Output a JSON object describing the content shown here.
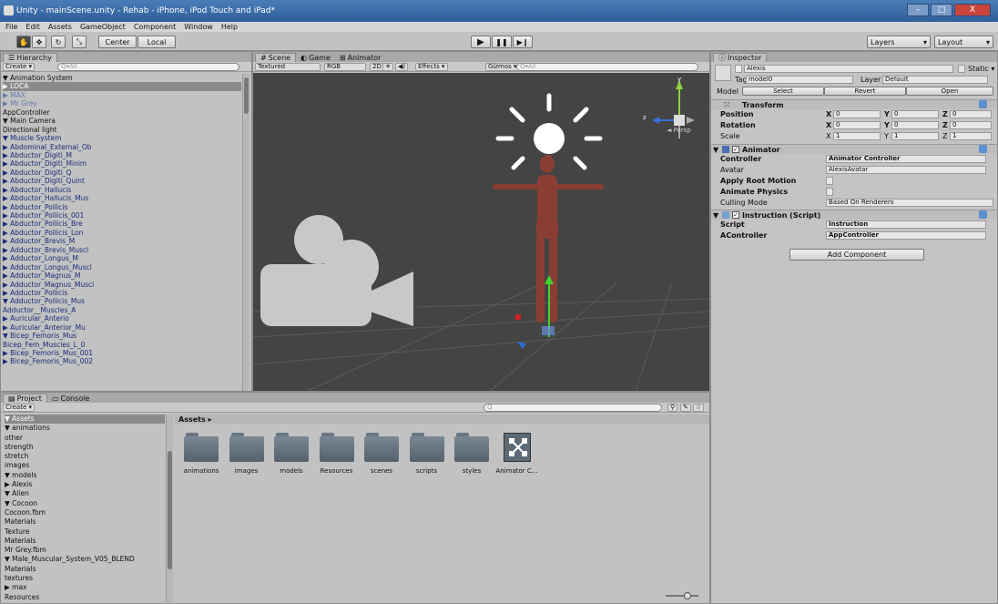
{
  "window": {
    "title": "Unity - mainScene.unity - Rehab - iPhone, iPod Touch and iPad*",
    "min": "–",
    "max": "□",
    "close": "X"
  },
  "menu": [
    "File",
    "Edit",
    "Assets",
    "GameObject",
    "Component",
    "Window",
    "Help"
  ],
  "toolbar": {
    "center": "Center",
    "local": "Local",
    "play": "▶",
    "pause": "❚❚",
    "step": "▶❙",
    "layers": "Layers",
    "layout": "Layout",
    "hand": "✋",
    "move": "✥",
    "rotate": "↻",
    "scale": "⤡"
  },
  "hierarchy": {
    "tab": "Hierarchy",
    "create": "Create ▾",
    "search": "Q▾All",
    "rows": [
      {
        "t": "▼ Animation System",
        "c": "blk"
      },
      {
        "t": "   ▶ LOCA",
        "c": "sel"
      },
      {
        "t": "   ▶ MAX",
        "c": "dim"
      },
      {
        "t": "   ▶ Mr Grey",
        "c": "dim"
      },
      {
        "t": "   AppController",
        "c": "blk"
      },
      {
        "t": "▼ Main Camera",
        "c": "blk"
      },
      {
        "t": "      Directional light",
        "c": "blk"
      },
      {
        "t": "▼ Muscle System",
        "c": ""
      },
      {
        "t": "   ▶ Abdominal_External_Ob",
        "c": ""
      },
      {
        "t": "   ▶ Abductor_Digiti_M",
        "c": ""
      },
      {
        "t": "   ▶ Abductor_Digiti_Minim",
        "c": ""
      },
      {
        "t": "   ▶ Abductor_Digiti_Q",
        "c": ""
      },
      {
        "t": "   ▶ Abductor_Digiti_Quint",
        "c": ""
      },
      {
        "t": "   ▶ Abductor_Hallucis",
        "c": ""
      },
      {
        "t": "   ▶ Abductor_Hallucis_Mus",
        "c": ""
      },
      {
        "t": "   ▶ Abductor_Pollicis",
        "c": ""
      },
      {
        "t": "   ▶ Abductor_Pollicis_001",
        "c": ""
      },
      {
        "t": "   ▶ Abductor_Pollicis_Bre",
        "c": ""
      },
      {
        "t": "   ▶ Abductor_Pollicis_Lon",
        "c": ""
      },
      {
        "t": "   ▶ Adductor_Brevis_M",
        "c": ""
      },
      {
        "t": "   ▶ Adductor_Brevis_Muscl",
        "c": ""
      },
      {
        "t": "   ▶ Adductor_Longus_M",
        "c": ""
      },
      {
        "t": "   ▶ Adductor_Longus_Muscl",
        "c": ""
      },
      {
        "t": "   ▶ Adductor_Magnus_M",
        "c": ""
      },
      {
        "t": "   ▶ Adductor_Magnus_Muscl",
        "c": ""
      },
      {
        "t": "   ▶ Adductor_Pollicis",
        "c": ""
      },
      {
        "t": "   ▼ Adductor_Pollicis_Mus",
        "c": ""
      },
      {
        "t": "         Adductor__Muscles_A",
        "c": ""
      },
      {
        "t": "   ▶ Auricular_Anterio",
        "c": ""
      },
      {
        "t": "   ▶ Auricular_Anterior_Mu",
        "c": ""
      },
      {
        "t": "   ▼ Bicep_Femoris_Mus",
        "c": ""
      },
      {
        "t": "         Bicep_Fem_Muscles_L_0",
        "c": ""
      },
      {
        "t": "   ▶ Bicep_Femoris_Mus_001",
        "c": ""
      },
      {
        "t": "   ▶ Bicep_Femoris_Mus_002",
        "c": ""
      }
    ]
  },
  "scene": {
    "tabs": [
      "Scene",
      "Game",
      "Animator"
    ],
    "shading": "Textured",
    "render": "RGB",
    "two_d": "2D",
    "effects": "Effects ▾",
    "gizmos": "Gizmos ▾",
    "search": "Q▾All",
    "persp": "◄ Persp"
  },
  "inspector": {
    "tab": "Inspector",
    "object_name": "Alexis",
    "static": "Static ▾",
    "tag_label": "Tag",
    "tag": "model0",
    "layer_label": "Layer",
    "layer": "Default",
    "model_label": "Model",
    "select": "Select",
    "revert": "Revert",
    "open": "Open",
    "transform": {
      "title": "Transform",
      "position": "Position",
      "rotation": "Rotation",
      "scale": "Scale",
      "x": "X",
      "y": "Y",
      "z": "Z",
      "pos": [
        "0",
        "0",
        "0"
      ],
      "rot": [
        "0",
        "0",
        "0"
      ],
      "scl": [
        "1",
        "1",
        "1"
      ]
    },
    "animator": {
      "title": "Animator",
      "controller_label": "Controller",
      "controller": "Animator Controller",
      "avatar_label": "Avatar",
      "avatar": "AlexisAvatar",
      "root_motion": "Apply Root Motion",
      "anim_physics": "Animate Physics",
      "culling_label": "Culling Mode",
      "culling": "Based On Renderers"
    },
    "instruction": {
      "title": "Instruction (Script)",
      "script_label": "Script",
      "script": "Instruction",
      "acontroller_label": "AController",
      "acontroller": "AppController"
    },
    "add_component": "Add Component"
  },
  "project": {
    "tabs": [
      "Project",
      "Console"
    ],
    "create": "Create ▾",
    "assets_header": "Assets",
    "tree": [
      {
        "t": "▼ Assets",
        "c": "sel"
      },
      {
        "t": "  ▼ animations",
        "c": "blk"
      },
      {
        "t": "        other",
        "c": "blk"
      },
      {
        "t": "        strength",
        "c": "blk"
      },
      {
        "t": "        stretch",
        "c": "blk"
      },
      {
        "t": "     images",
        "c": "blk"
      },
      {
        "t": "  ▼ models",
        "c": "blk"
      },
      {
        "t": "     ▶ Alexis",
        "c": "blk"
      },
      {
        "t": "     ▼ Alien",
        "c": "blk"
      },
      {
        "t": "        ▼ Cocoon",
        "c": "blk"
      },
      {
        "t": "              Cocoon.fbm",
        "c": "blk"
      },
      {
        "t": "              Materials",
        "c": "blk"
      },
      {
        "t": "              Texture",
        "c": "blk"
      },
      {
        "t": "           Materials",
        "c": "blk"
      },
      {
        "t": "           Mr Grey.fbm",
        "c": "blk"
      },
      {
        "t": "  ▼ Male_Muscular_System_V05_BLEND",
        "c": "blk"
      },
      {
        "t": "        Materials",
        "c": "blk"
      },
      {
        "t": "        textures",
        "c": "blk"
      },
      {
        "t": "  ▶ max",
        "c": "blk"
      },
      {
        "t": "     Resources",
        "c": "blk"
      }
    ],
    "breadcrumb": "Assets ▸",
    "items": [
      "animations",
      "images",
      "models",
      "Resources",
      "scenes",
      "scripts",
      "styles",
      "Animator C..."
    ]
  }
}
